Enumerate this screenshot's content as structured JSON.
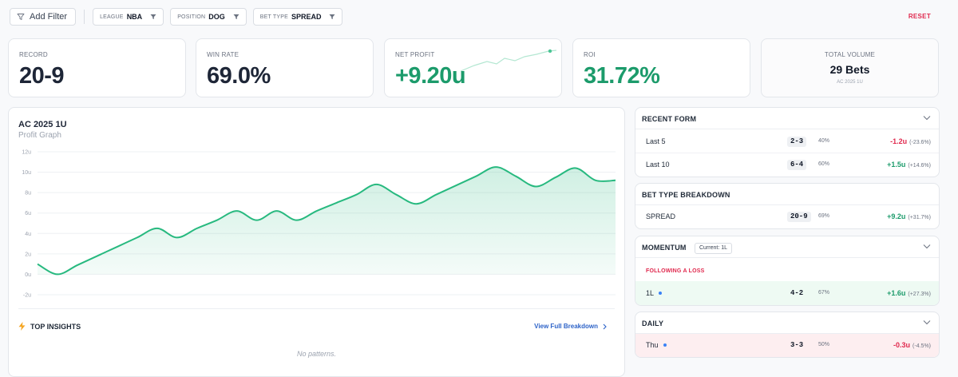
{
  "filters": {
    "add_label": "Add Filter",
    "chips": [
      {
        "key": "LEAGUE",
        "value": "NBA"
      },
      {
        "key": "POSITION",
        "value": "DOG"
      },
      {
        "key": "BET TYPE",
        "value": "SPREAD"
      }
    ],
    "reset_label": "RESET"
  },
  "stats": {
    "record": {
      "label": "RECORD",
      "value": "20-9"
    },
    "win_rate": {
      "label": "WIN RATE",
      "value": "69.0%"
    },
    "net_profit": {
      "label": "NET PROFIT",
      "value": "+9.20u"
    },
    "roi": {
      "label": "ROI",
      "value": "31.72%"
    },
    "total_volume": {
      "label": "TOTAL VOLUME",
      "value": "29 Bets",
      "sub": "AC 2025 1U"
    }
  },
  "colors": {
    "accent_green": "#1c9b6b",
    "line_green": "#27b97f",
    "negative_red": "#e0284d",
    "link_blue": "#2d63c8"
  },
  "profit_chart": {
    "title": "AC 2025 1U",
    "subtitle": "Profit Graph"
  },
  "chart_data": {
    "type": "area",
    "title": "AC 2025 1U",
    "subtitle": "Profit Graph",
    "xlabel": "",
    "ylabel": "",
    "ylim": [
      -2,
      12
    ],
    "yticks": [
      12,
      10,
      8,
      6,
      4,
      2,
      0,
      -2
    ],
    "ytick_labels": [
      "12u",
      "10u",
      "8u",
      "6u",
      "4u",
      "2u",
      "0u",
      "-2u"
    ],
    "grid": true,
    "x": [
      0,
      1,
      2,
      3,
      4,
      5,
      6,
      7,
      8,
      9,
      10,
      11,
      12,
      13,
      14,
      15,
      16,
      17,
      18,
      19,
      20,
      21,
      22,
      23,
      24,
      25,
      26,
      27,
      28,
      29
    ],
    "values": [
      1.0,
      0.0,
      0.9,
      1.8,
      2.7,
      3.6,
      4.5,
      3.6,
      4.5,
      5.3,
      6.2,
      5.3,
      6.2,
      5.3,
      6.2,
      7.0,
      7.8,
      8.8,
      7.8,
      6.9,
      7.8,
      8.7,
      9.6,
      10.5,
      9.6,
      8.6,
      9.5,
      10.4,
      9.2,
      9.2
    ]
  },
  "insights": {
    "title": "TOP INSIGHTS",
    "link": "View Full Breakdown",
    "empty": "No patterns."
  },
  "recent_form": {
    "title": "RECENT FORM",
    "rows": [
      {
        "name": "Last 5",
        "record": "2-3",
        "pct": "40%",
        "units": "-1.2u",
        "roi": "(-23.6%)"
      },
      {
        "name": "Last 10",
        "record": "6-4",
        "pct": "60%",
        "units": "+1.5u",
        "roi": "(+14.6%)"
      }
    ]
  },
  "bet_type": {
    "title": "BET TYPE BREAKDOWN",
    "rows": [
      {
        "name": "SPREAD",
        "record": "20-9",
        "pct": "69%",
        "units": "+9.2u",
        "roi": "(+31.7%)"
      }
    ]
  },
  "momentum": {
    "title": "MOMENTUM",
    "current": "Current: 1L",
    "section": "FOLLOWING A LOSS",
    "rows": [
      {
        "name": "1L",
        "record": "4-2",
        "pct": "67%",
        "units": "+1.6u",
        "roi": "(+27.3%)"
      }
    ]
  },
  "daily": {
    "title": "DAILY",
    "rows": [
      {
        "name": "Thu",
        "record": "3-3",
        "pct": "50%",
        "units": "-0.3u",
        "roi": "(-4.5%)"
      }
    ]
  }
}
